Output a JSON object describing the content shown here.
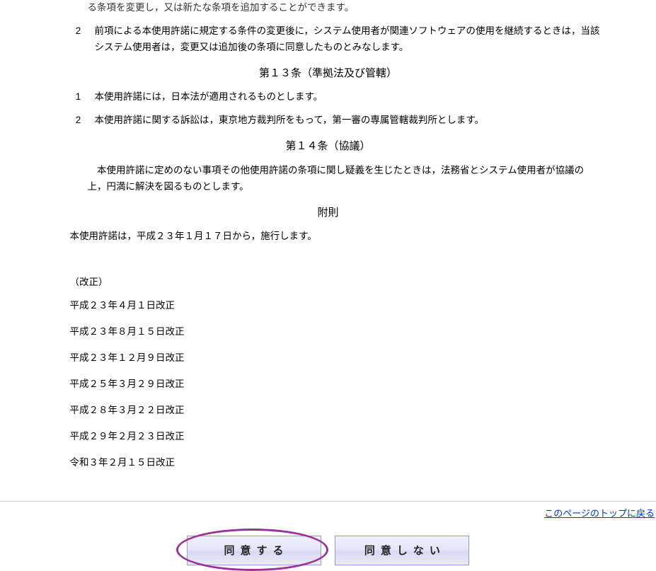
{
  "cutLine": "る条項を変更し，又は新たな条項を追加することができます。",
  "article12": {
    "item2": {
      "num": "2",
      "text": "前項による本使用許諾に規定する条件の変更後に，システム使用者が関連ソフトウェアの使用を継続するときは，当該システム使用者は，変更又は追加後の条項に同意したものとみなします。"
    }
  },
  "article13": {
    "heading": "第１３条（準拠法及び管轄）",
    "item1": {
      "num": "1",
      "text": "本使用許諾には，日本法が適用されるものとします。"
    },
    "item2": {
      "num": "2",
      "text": "本使用許諾に関する訴訟は，東京地方裁判所をもって，第一審の専属管轄裁判所とします。"
    }
  },
  "article14": {
    "heading": "第１４条（協議）",
    "body": "本使用許諾に定めのない事項その他使用許諾の条項に関し疑義を生じたときは，法務省とシステム使用者が協議の上，円満に解決を図るものとします。"
  },
  "supplementary": {
    "heading": "附則",
    "body": "本使用許諾は，平成２３年１月１７日から，施行します。"
  },
  "revisions": {
    "label": "（改正）",
    "items": [
      "平成２３年４月１日改正",
      "平成２３年８月１５日改正",
      "平成２３年１２月９日改正",
      "平成２５年３月２９日改正",
      "平成２８年３月２２日改正",
      "平成２９年２月２３日改正",
      "令和３年２月１５日改正"
    ]
  },
  "backToTop": "このページのトップに戻る",
  "buttons": {
    "agree": "同意する",
    "disagree": "同意しない"
  }
}
